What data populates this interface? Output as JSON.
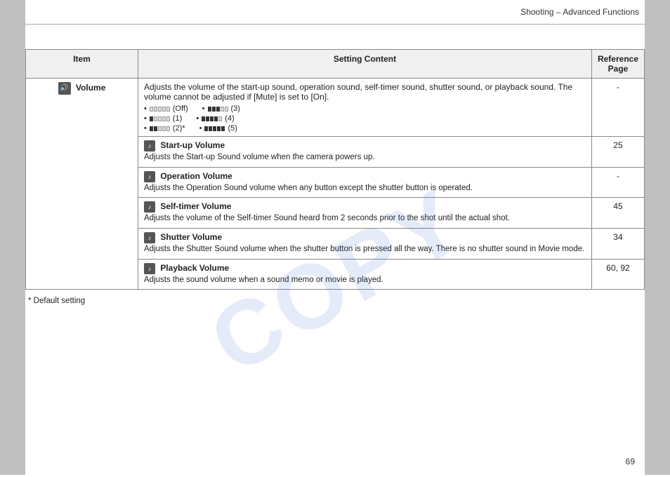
{
  "header": {
    "title": "Shooting – Advanced Functions"
  },
  "table": {
    "col_item": "Item",
    "col_content": "Setting Content",
    "col_ref": "Reference Page",
    "item_label": "Volume",
    "main_desc": "Adjusts the volume of the start-up sound, operation sound, self-timer sound, shutter sound, or playback sound. The volume cannot be adjusted if [Mute] is set to [On].",
    "vol_off_label": "(Off)",
    "vol_1_label": "(1)",
    "vol_2_label": "(2)*",
    "vol_3_label": "(3)",
    "vol_4_label": "(4)",
    "vol_5_label": "(5)",
    "main_ref": "-",
    "rows": [
      {
        "icon_char": "♪",
        "header": "Start-up Volume",
        "desc": "Adjusts the Start-up Sound volume when the camera powers up.",
        "ref": "25"
      },
      {
        "icon_char": "♪",
        "header": "Operation Volume",
        "desc": "Adjusts the Operation Sound volume when any button except the shutter button is operated.",
        "ref": "-"
      },
      {
        "icon_char": "♪",
        "header": "Self-timer Volume",
        "desc": "Adjusts the volume of the Self-timer Sound heard from 2 seconds prior to the shot until the actual shot.",
        "ref": "45"
      },
      {
        "icon_char": "♪",
        "header": "Shutter Volume",
        "desc": "Adjusts the Shutter Sound volume when the shutter button is pressed all the way. There is no shutter sound in Movie mode.",
        "ref": "34"
      },
      {
        "icon_char": "♪",
        "header": "Playback Volume",
        "desc": "Adjusts the sound volume when a sound memo or movie is played.",
        "ref": "60, 92"
      }
    ]
  },
  "footer": {
    "note": "* Default setting"
  },
  "page_number": "69",
  "watermark": "COPY"
}
